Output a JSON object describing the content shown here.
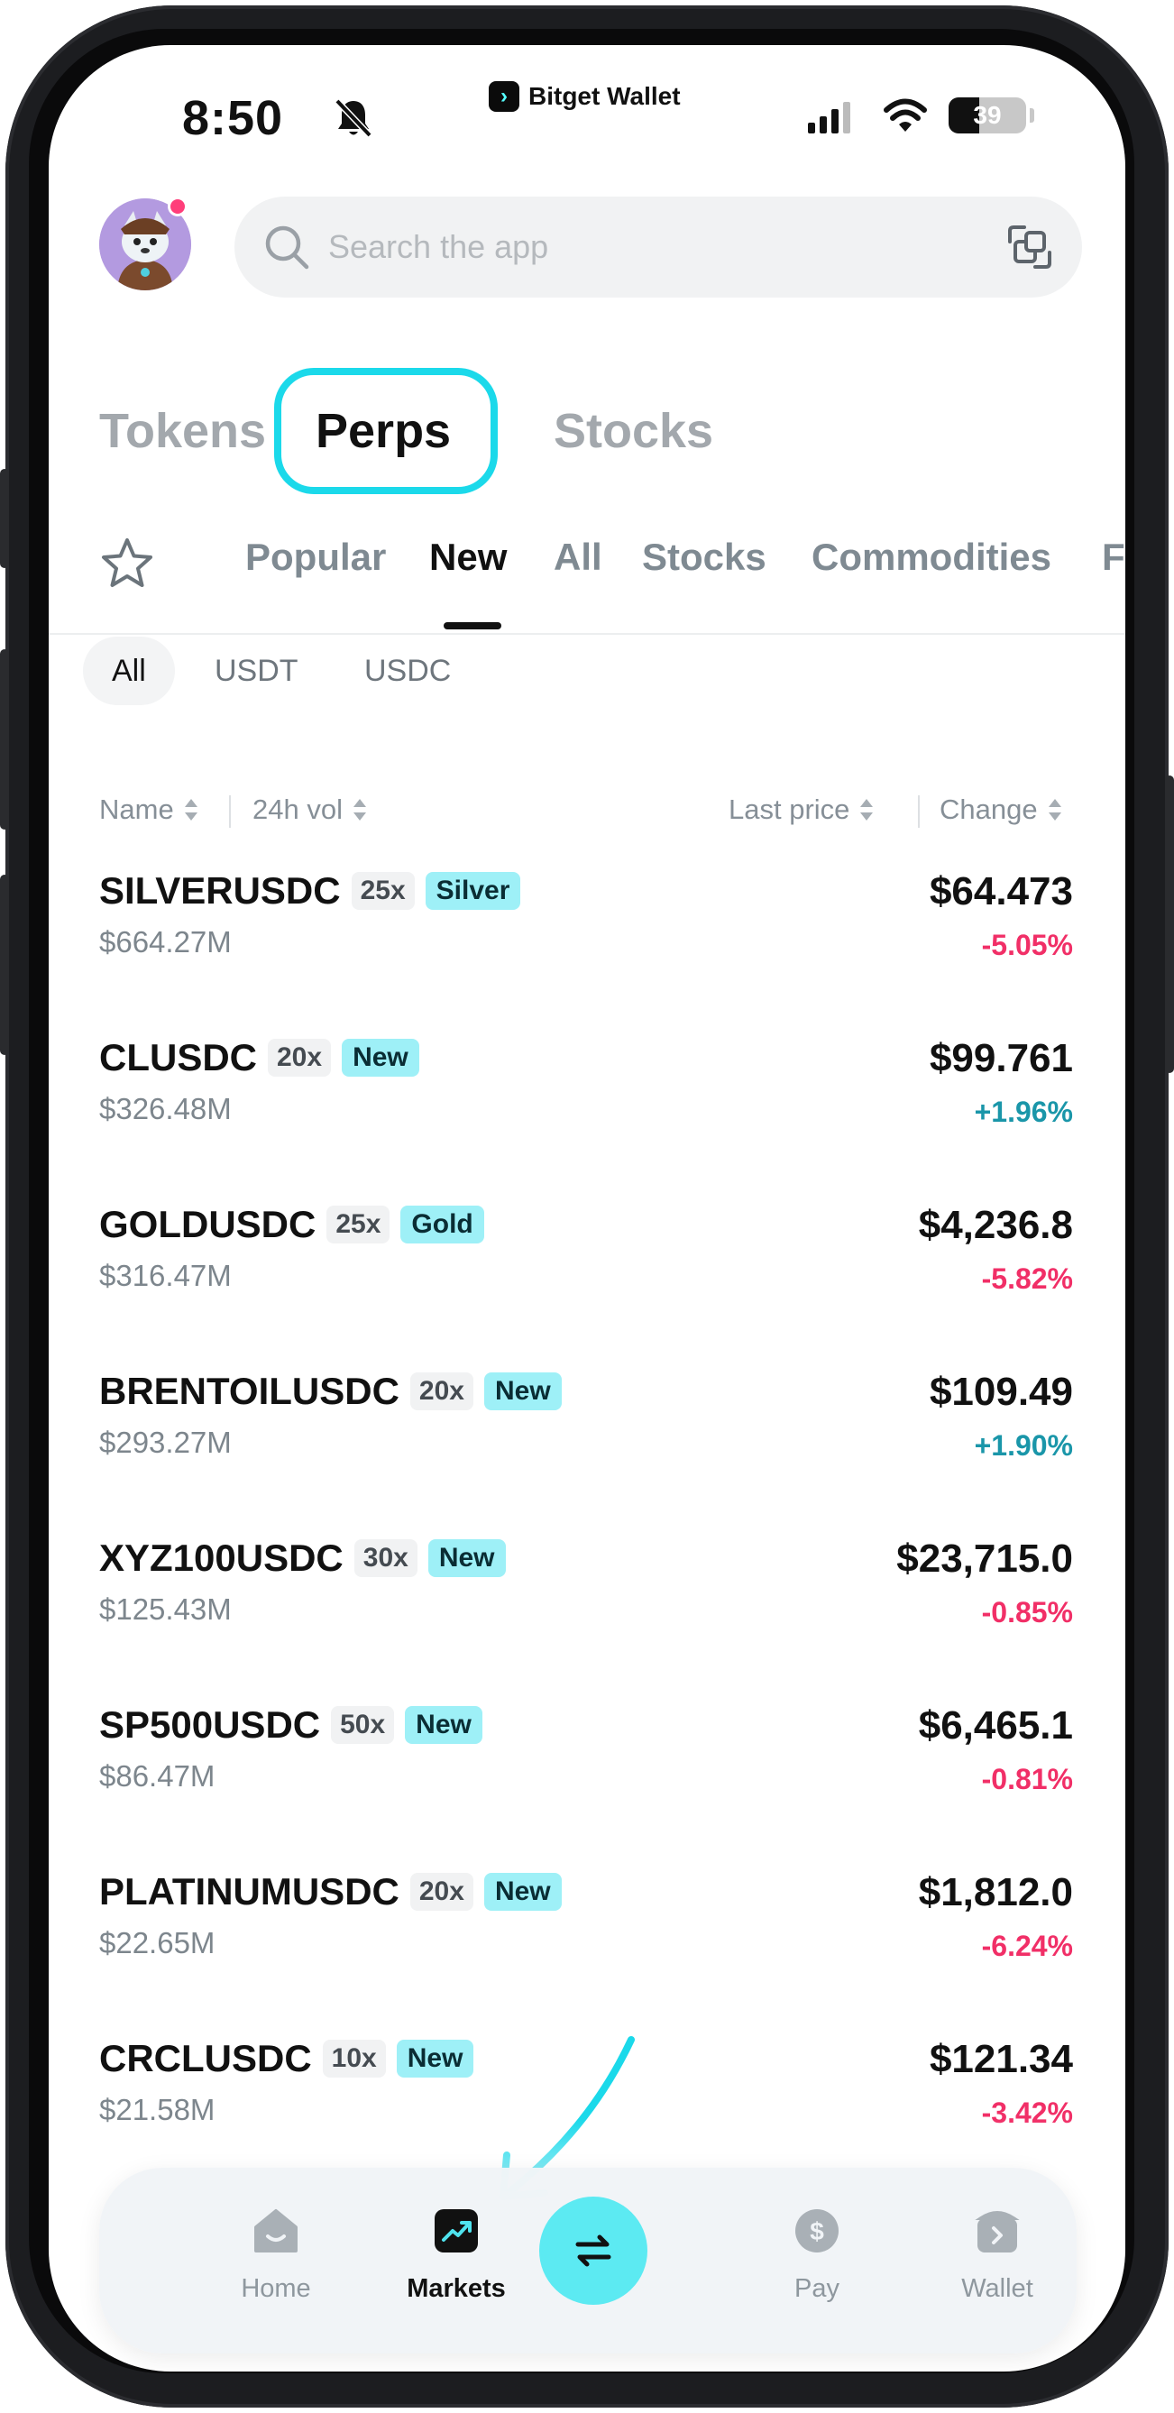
{
  "status_bar": {
    "time": "8:50",
    "battery": "39",
    "battery_level": 0.39
  },
  "brand": {
    "name": "Bitget Wallet"
  },
  "search": {
    "placeholder": "Search the app"
  },
  "top_tabs": [
    {
      "label": "Tokens",
      "active": false
    },
    {
      "label": "Perps",
      "active": true
    },
    {
      "label": "Stocks",
      "active": false
    }
  ],
  "sub_tabs": [
    {
      "label": "Popular",
      "active": false
    },
    {
      "label": "New",
      "active": true
    },
    {
      "label": "All",
      "active": false
    },
    {
      "label": "Stocks",
      "active": false
    },
    {
      "label": "Commodities",
      "active": false
    },
    {
      "label": "Fo",
      "active": false
    }
  ],
  "chips": [
    {
      "label": "All",
      "active": true
    },
    {
      "label": "USDT",
      "active": false
    },
    {
      "label": "USDC",
      "active": false
    }
  ],
  "list_header": {
    "name": "Name",
    "vol": "24h vol",
    "price": "Last price",
    "change": "Change"
  },
  "rows": [
    {
      "symbol": "SILVERUSDC",
      "leverage": "25x",
      "tag": "Silver",
      "vol": "$664.27M",
      "price": "$64.473",
      "change": "-5.05%",
      "direction": "down"
    },
    {
      "symbol": "CLUSDC",
      "leverage": "20x",
      "tag": "New",
      "vol": "$326.48M",
      "price": "$99.761",
      "change": "+1.96%",
      "direction": "up"
    },
    {
      "symbol": "GOLDUSDC",
      "leverage": "25x",
      "tag": "Gold",
      "vol": "$316.47M",
      "price": "$4,236.8",
      "change": "-5.82%",
      "direction": "down"
    },
    {
      "symbol": "BRENTOILUSDC",
      "leverage": "20x",
      "tag": "New",
      "vol": "$293.27M",
      "price": "$109.49",
      "change": "+1.90%",
      "direction": "up"
    },
    {
      "symbol": "XYZ100USDC",
      "leverage": "30x",
      "tag": "New",
      "vol": "$125.43M",
      "price": "$23,715.0",
      "change": "-0.85%",
      "direction": "down"
    },
    {
      "symbol": "SP500USDC",
      "leverage": "50x",
      "tag": "New",
      "vol": "$86.47M",
      "price": "$6,465.1",
      "change": "-0.81%",
      "direction": "down"
    },
    {
      "symbol": "PLATINUMUSDC",
      "leverage": "20x",
      "tag": "New",
      "vol": "$22.65M",
      "price": "$1,812.0",
      "change": "-6.24%",
      "direction": "down"
    },
    {
      "symbol": "CRCLUSDC",
      "leverage": "10x",
      "tag": "New",
      "vol": "$21.58M",
      "price": "$121.34",
      "change": "-3.42%",
      "direction": "down"
    }
  ],
  "bottom_nav": [
    {
      "label": "Home",
      "icon": "home-icon",
      "active": false
    },
    {
      "label": "Markets",
      "icon": "markets-icon",
      "active": true
    },
    {
      "label": "",
      "icon": "swap-icon",
      "active": false
    },
    {
      "label": "Pay",
      "icon": "pay-icon",
      "active": false
    },
    {
      "label": "Wallet",
      "icon": "wallet-icon",
      "active": false
    }
  ],
  "colors": {
    "accent": "#1bd9ea",
    "negative": "#f12f67",
    "positive": "#1a96a9",
    "tag_bg": "#9ef0f7",
    "swap_button": "#5ceaf2"
  }
}
